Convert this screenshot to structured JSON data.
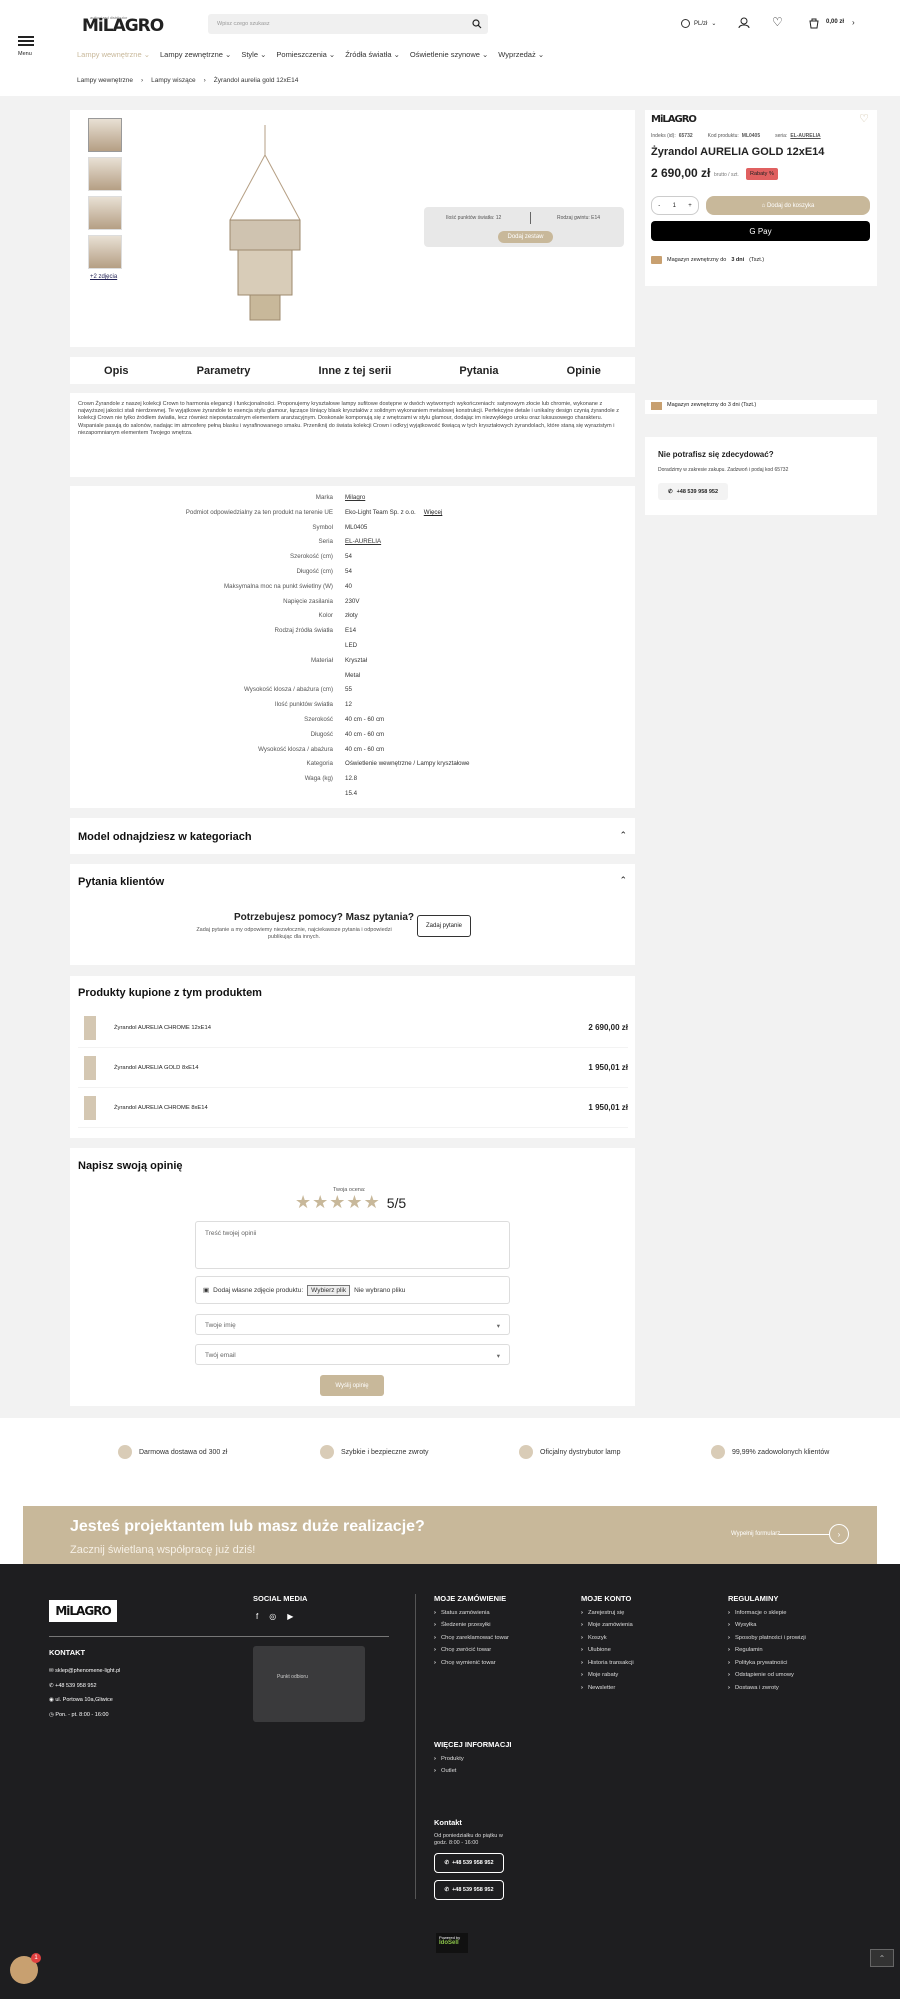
{
  "header": {
    "menu_label": "Menu",
    "logo_tag": "authorized distributor",
    "logo": "MiLAGRO",
    "search_placeholder": "Wpisz czego szukasz",
    "lang": "PL/zł",
    "cart_total": "0,00 zł",
    "nav": [
      "Lampy wewnętrzne",
      "Lampy zewnętrzne",
      "Style",
      "Pomieszczenia",
      "Źródła światła",
      "Oświetlenie szynowe",
      "Wyprzedaż"
    ],
    "breadcrumbs": [
      "Lampy wewnętrzne",
      "Lampy wiszące",
      "Żyrandol aurelia gold 12xE14"
    ]
  },
  "product": {
    "more_photos": "+2 zdjęcia",
    "brand": "MiLAGRO",
    "index_label": "Indeks (id):",
    "index_value": "65732",
    "code_label": "Kod produktu:",
    "code_value": "ML0405",
    "series_label": "seria:",
    "series_value": "EL-AURELIA",
    "title": "Żyrandol AURELIA GOLD 12xE14",
    "price": "2 690,00 zł",
    "price_note": "brutto / szt.",
    "discount_badge": "Rabaty %",
    "qty_minus": "-",
    "qty_value": "1",
    "qty_plus": "+",
    "add_to_cart": "Dodaj do koszyka",
    "gpay": "G Pay",
    "availability_pre": "Magazyn zewnętrzny do",
    "availability_days": "3 dni",
    "availability_post": "(Tszt.)",
    "availability_days_word": "dni",
    "bundle_points": "Ilość punktów światła: 12",
    "bundle_socket": "Rodzaj gwintu: E14",
    "bundle_button": "Dodaj zestaw"
  },
  "tabs": [
    "Opis",
    "Parametry",
    "Inne z tej serii",
    "Pytania",
    "Opinie"
  ],
  "description": "Crown Żyrandole z naszej kolekcji Crown to harmonia elegancji i funkcjonalności. Proponujemy kryształowe lampy sufitowe dostępne w dwóch wytwornych wykończeniach: satynowym złocie lub chromie, wykonane z najwyższej jakości stali nierdzewnej. Te wyjątkowe żyrandole to esencja stylu glamour, łączące lśniący blask kryształów z solidnym wykonaniem metalowej konstrukcji. Perfekcyjne detale i unikalny design czynią żyrandole z kolekcji Crown nie tylko źródłem światła, lecz również niepowtarzalnym elementem aranżacyjnym. Doskonale komponują się z wnętrzami w stylu glamour, dodając im niezwykłego uroku oraz luksusowego charakteru. Wspaniale pasują do salonów, nadając im atmosferę pełną blasku i wyrafinowanego smaku. Przeniknij do świata kolekcji Crown i odkryj wyjątkowość tkwiącą w tych kryształowych żyrandolach, które staną się wyrazistym i niezapomnianym elementem Twojego wnętrza.",
  "side": {
    "availability_repeat": "Magazyn zewnętrzny do 3 dni (Tszt.)",
    "undecided_title": "Nie potrafisz się zdecydować?",
    "undecided_text": "Doradzimy w zakresie zakupu. Zadzwoń i podaj kod 65732",
    "phone": "+48 539 958 952"
  },
  "params": [
    {
      "label": "Marka",
      "value": "Milagro"
    },
    {
      "label": "Podmiot odpowiedzialny za ten produkt na terenie UE",
      "value": "Eko-Light Team Sp. z o.o.",
      "extra": "Więcej"
    },
    {
      "label": "Symbol",
      "value": "ML0405"
    },
    {
      "label": "Seria",
      "value": "EL-AURELIA"
    },
    {
      "label": "Szerokość (cm)",
      "value": "54"
    },
    {
      "label": "Długość (cm)",
      "value": "54"
    },
    {
      "label": "Maksymalna moc na punkt świetlny (W)",
      "value": "40"
    },
    {
      "label": "Napięcie zasilania",
      "value": "230V"
    },
    {
      "label": "Kolor",
      "value": "złoty"
    },
    {
      "label": "Rodzaj źródła światła",
      "value": "E14"
    },
    {
      "label": "",
      "value": "LED"
    },
    {
      "label": "Materiał",
      "value": "Kryształ"
    },
    {
      "label": "",
      "value": "Metal"
    },
    {
      "label": "Wysokość klosza / abażura (cm)",
      "value": "55"
    },
    {
      "label": "Ilość punktów światła",
      "value": "12"
    },
    {
      "label": "Szerokość",
      "value": "40 cm - 60 cm"
    },
    {
      "label": "Długość",
      "value": "40 cm - 60 cm"
    },
    {
      "label": "Wysokość klosza / abażura",
      "value": "40 cm - 60 cm"
    },
    {
      "label": "Kategoria",
      "value": "Oświetlenie wewnętrzne / Lampy kryształowe"
    },
    {
      "label": "Waga (kg)",
      "value": "12.8"
    },
    {
      "label": "",
      "value": "15.4"
    }
  ],
  "categories_section": "Model odnajdziesz w kategoriach",
  "questions": {
    "title": "Pytania klientów",
    "help_title": "Potrzebujesz pomocy? Masz pytania?",
    "help_text": "Zadaj pytanie a my odpowiemy niezwłocznie, najciekawsze pytania i odpowiedzi publikując dla innych.",
    "ask_button": "Zadaj pytanie"
  },
  "bought": {
    "title": "Produkty kupione z tym produktem",
    "items": [
      {
        "name": "Żyrandol AURELIA CHROME 12xE14",
        "price": "2 690,00 zł"
      },
      {
        "name": "Żyrandol AURELIA GOLD 8xE14",
        "price": "1 950,01 zł"
      },
      {
        "name": "Żyrandol AURELIA CHROME 8xE14",
        "price": "1 950,01 zł"
      }
    ]
  },
  "review": {
    "title": "Napisz swoją opinię",
    "your_rating": "Twoja ocena:",
    "score": "5/5",
    "stars": 5,
    "textarea_placeholder": "Treść twojej opinii",
    "photo_label": "Dodaj własne zdjęcie produktu:",
    "file_button": "Wybierz plik",
    "file_status": "Nie wybrano pliku",
    "name_placeholder": "Twoje imię",
    "email_placeholder": "Twój email",
    "submit": "Wyślij opinię"
  },
  "usps": [
    "Darmowa dostawa od 300 zł",
    "Szybkie i bezpieczne zwroty",
    "Oficjalny dystrybutor lamp",
    "99,99% zadowolonych klientów"
  ],
  "banner": {
    "title": "Jesteś projektantem lub masz duże realizacje?",
    "subtitle": "Zacznij świetlaną współpracę już dziś!",
    "cta": "Wypełnij formularz"
  },
  "footer": {
    "social_title": "SOCIAL MEDIA",
    "contact_title": "KONTAKT",
    "contact": [
      "sklep@phenomene-light.pl",
      "+48 539 958 952",
      "ul. Portowa 10a,Gliwice",
      "Pon. - pt. 8:00 - 16:00"
    ],
    "map_label": "Punkt odbioru",
    "orders_title": "MOJE ZAMÓWIENIE",
    "orders": [
      "Status zamówienia",
      "Śledzenie przesyłki",
      "Chcę zareklamować towar",
      "Chcę zwrócić towar",
      "Chcę wymienić towar"
    ],
    "account_title": "MOJE KONTO",
    "account": [
      "Zarejestruj się",
      "Moje zamówienia",
      "Koszyk",
      "Ulubione",
      "Historia transakcji",
      "Moje rabaty",
      "Newsletter"
    ],
    "rules_title": "REGULAMINY",
    "rules": [
      "Informacje o sklepie",
      "Wysyłka",
      "Sposoby płatności i prowizji",
      "Regulamin",
      "Polityka prywatności",
      "Odstąpienie od umowy",
      "Dostawa i zwroty"
    ],
    "more_title": "WIĘCEJ INFORMACJI",
    "more": [
      "Produkty",
      "Outlet"
    ],
    "kontakt_title": "Kontakt",
    "hours": "Od poniedziałku do piątku w godz. 8:00 - 16:00",
    "phone1": "+48 539 958 952",
    "phone2": "+48 539 958 952",
    "powered": "Powered by",
    "powered_brand": "IdoSell",
    "chat_badge": "1"
  },
  "colors": {
    "accent": "#c8b89a",
    "badge": "#e06060",
    "footer_bg": "#1e1e20"
  }
}
